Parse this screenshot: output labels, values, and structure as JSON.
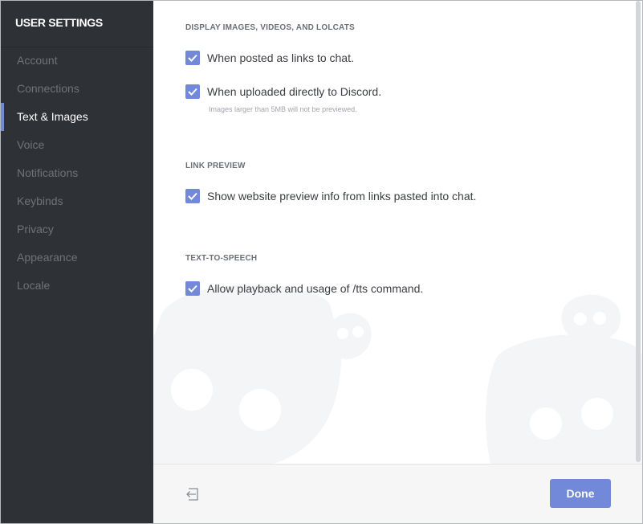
{
  "sidebar": {
    "title": "USER SETTINGS",
    "items": [
      {
        "label": "Account"
      },
      {
        "label": "Connections"
      },
      {
        "label": "Text & Images",
        "active": true
      },
      {
        "label": "Voice"
      },
      {
        "label": "Notifications"
      },
      {
        "label": "Keybinds"
      },
      {
        "label": "Privacy"
      },
      {
        "label": "Appearance"
      },
      {
        "label": "Locale"
      }
    ]
  },
  "sections": {
    "display": {
      "title": "DISPLAY IMAGES, VIDEOS, AND LOLCATS",
      "links_label": "When posted as links to chat.",
      "links_checked": true,
      "uploaded_label": "When uploaded directly to Discord.",
      "uploaded_checked": true,
      "uploaded_hint": "Images larger than 5MB will not be previewed."
    },
    "link_preview": {
      "title": "LINK PREVIEW",
      "label": "Show website preview info from links pasted into chat.",
      "checked": true
    },
    "tts": {
      "title": "TEXT-TO-SPEECH",
      "label": "Allow playback and usage of /tts command.",
      "checked": true
    }
  },
  "footer": {
    "done_label": "Done",
    "logout_icon": "logout-icon"
  },
  "colors": {
    "accent": "#7289da",
    "sidebar_bg": "#2e3136",
    "footer_bg": "#f6f6f7"
  }
}
